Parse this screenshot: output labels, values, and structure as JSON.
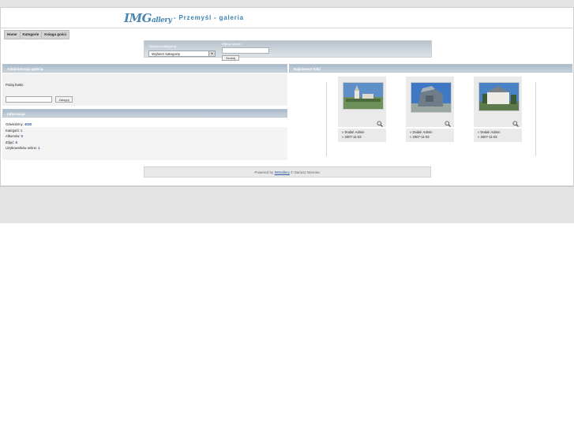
{
  "header": {
    "logo_main": "IMG",
    "logo_sub": "allery",
    "site_title": "- Przemyśl - galeria"
  },
  "menu": {
    "items": [
      "Home",
      "Kategorie",
      "Księga gości"
    ]
  },
  "search": {
    "category_label": "Wybierz kategorię",
    "category_value": "Wybierz kategorię",
    "keyword_label": "Wpisz słowo",
    "search_button": "Szukaj"
  },
  "admin": {
    "header": "Administracja galerią",
    "password_label": "Podaj hasło:",
    "login_button": "Zaloguj"
  },
  "info": {
    "header": "Informacje",
    "visits_label": "Odwiedziny:",
    "visits_value": "4020",
    "categories_label": "Kategorii:",
    "categories_value": "1",
    "albums_label": "Albumów:",
    "albums_value": "0",
    "photos_label": "Zdjęć:",
    "photos_value": "6",
    "online_label": "Użytkowników online:",
    "online_value": "1"
  },
  "latest": {
    "header": "Najnowsze fotki",
    "photos": [
      {
        "added_by": "» Dodał: Admin",
        "date": "» 2007-11-03"
      },
      {
        "added_by": "» Dodał: Admin",
        "date": "» 2007-11-03"
      },
      {
        "added_by": "» Dodał: Admin",
        "date": "» 2007-11-03"
      }
    ]
  },
  "footer": {
    "powered_by": "Powered by",
    "brand_link": "IMGallery",
    "copyright": "© Dariusz Niemiec"
  },
  "colors": {
    "accent": "#3d7fb0",
    "panel_header": "#b2c2cf",
    "link": "#2a5b9a"
  }
}
